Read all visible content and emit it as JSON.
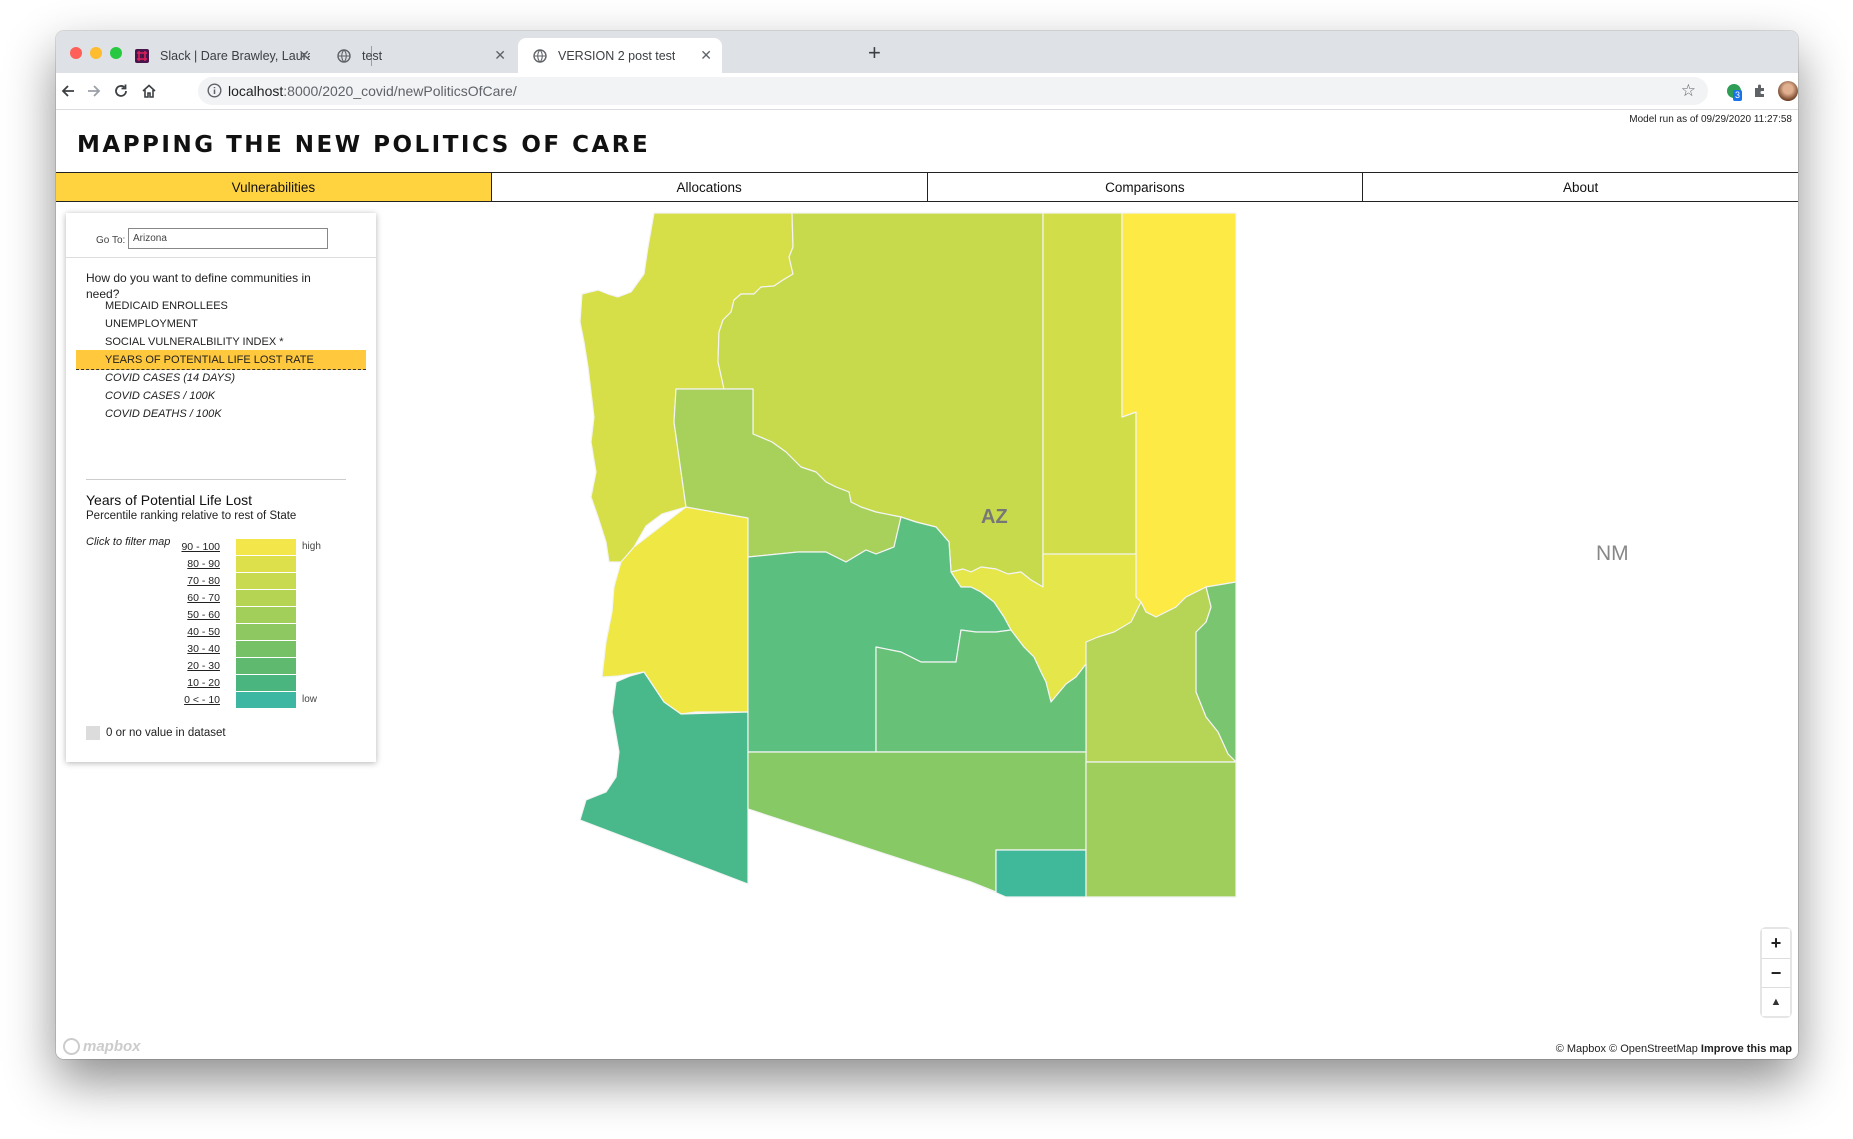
{
  "browser": {
    "tabs": [
      {
        "title": "Slack | Dare Brawley, Laura Ku",
        "icon": "slack-icon"
      },
      {
        "title": "test",
        "icon": "globe-icon"
      },
      {
        "title": "VERSION 2 post test",
        "icon": "globe-icon"
      }
    ],
    "active_tab": 2,
    "url_host": "localhost",
    "url_rest": ":8000/2020_covid/newPoliticsOfCare/",
    "extension_badge": "3"
  },
  "page": {
    "model_run": "Model run as of 09/29/2020 11:27:58",
    "title": "MAPPING THE NEW POLITICS OF CARE",
    "nav": [
      "Vulnerabilities",
      "Allocations",
      "Comparisons",
      "About"
    ],
    "nav_active": "Vulnerabilities"
  },
  "panel": {
    "goto_label": "Go To:",
    "goto_value": "Arizona",
    "question": "How do you want to define communities in need?",
    "options": [
      {
        "label": "MEDICAID ENROLLEES",
        "selected": false,
        "italic": false
      },
      {
        "label": "UNEMPLOYMENT",
        "selected": false,
        "italic": false
      },
      {
        "label": "SOCIAL VULNERALBILITY INDEX *",
        "selected": false,
        "italic": false
      },
      {
        "label": "YEARS OF POTENTIAL LIFE LOST RATE",
        "selected": true,
        "italic": false
      },
      {
        "label": "COVID CASES (14 DAYS)",
        "selected": false,
        "italic": true
      },
      {
        "label": "COVID CASES / 100K",
        "selected": false,
        "italic": true
      },
      {
        "label": "COVID DEATHS / 100K",
        "selected": false,
        "italic": true
      }
    ],
    "legend": {
      "title": "Years of Potential Life Lost",
      "subtitle": "Percentile ranking relative to rest of State",
      "click_hint": "Click to filter map",
      "high_label": "high",
      "low_label": "low",
      "bins": [
        {
          "range": "90 - 100",
          "color": "#f2e64a"
        },
        {
          "range": "80 - 90",
          "color": "#dde04a"
        },
        {
          "range": "70 - 80",
          "color": "#c8da50"
        },
        {
          "range": "60 - 70",
          "color": "#b5d454"
        },
        {
          "range": "50 - 60",
          "color": "#a2cf5a"
        },
        {
          "range": "40 - 50",
          "color": "#8dc860"
        },
        {
          "range": "30 - 40",
          "color": "#76c166"
        },
        {
          "range": "20 - 30",
          "color": "#5fba6f"
        },
        {
          "range": "10 - 20",
          "color": "#4ab57f"
        },
        {
          "range": "0 < - 10",
          "color": "#3db7a1"
        }
      ],
      "no_data_label": "0 or no value in dataset"
    }
  },
  "map": {
    "state_label": "AZ",
    "neighbor_label": "NM",
    "zoom_in": "+",
    "zoom_out": "−",
    "compass": "▲",
    "attribution": "© Mapbox © OpenStreetMap",
    "improve": "Improve this map",
    "logo": "mapbox"
  }
}
